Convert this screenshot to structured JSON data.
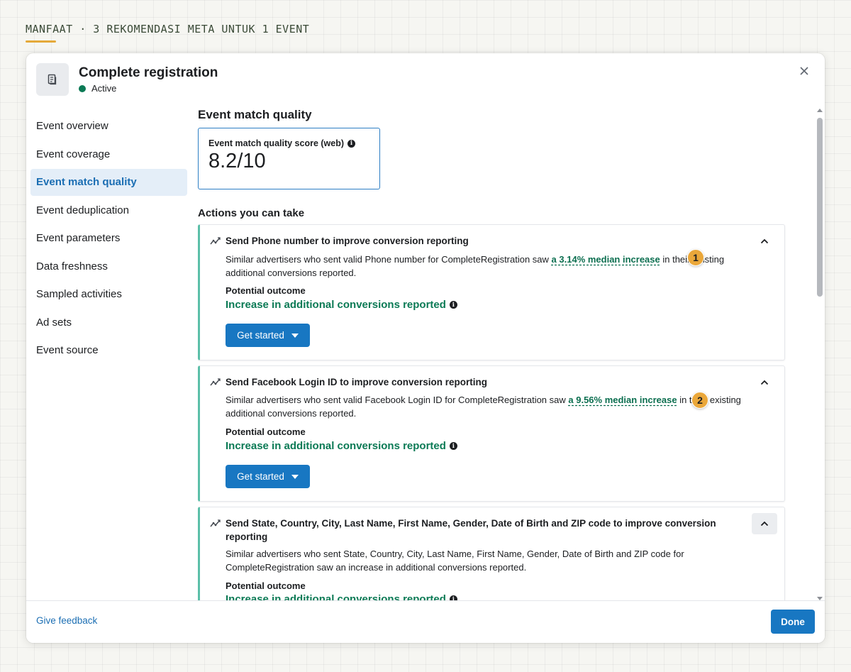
{
  "page": {
    "heading_tag": "MANFAAT · 3 REKOMENDASI META UNTUK 1 EVENT",
    "accent_color": "#e5a93a"
  },
  "modal": {
    "title": "Complete registration",
    "status": "Active",
    "status_color": "#0b7a55",
    "close_icon": "close-icon",
    "event_icon": "document-icon"
  },
  "sidebar": {
    "items": [
      {
        "label": "Event overview",
        "active": false
      },
      {
        "label": "Event coverage",
        "active": false
      },
      {
        "label": "Event match quality",
        "active": true
      },
      {
        "label": "Event deduplication",
        "active": false
      },
      {
        "label": "Event parameters",
        "active": false
      },
      {
        "label": "Data freshness",
        "active": false
      },
      {
        "label": "Sampled activities",
        "active": false
      },
      {
        "label": "Ad sets",
        "active": false
      },
      {
        "label": "Event source",
        "active": false
      }
    ]
  },
  "main": {
    "section_title": "Event match quality",
    "score_label": "Event match quality score (web)",
    "score_value": "8.2/10",
    "actions_title": "Actions you can take",
    "cards": [
      {
        "title": "Send Phone number to improve conversion reporting",
        "desc_before": "Similar advertisers who sent valid Phone number for CompleteRegistration saw ",
        "desc_link": "a 3.14% median increase",
        "desc_after": " in their existing additional conversions reported.",
        "outcome_label": "Potential outcome",
        "outcome_value": "Increase in additional conversions reported",
        "button_label": "Get started",
        "marker": "1"
      },
      {
        "title": "Send Facebook Login ID to improve conversion reporting",
        "desc_before": "Similar advertisers who sent valid Facebook Login ID for CompleteRegistration saw ",
        "desc_link": "a 9.56% median increase",
        "desc_after": " in their existing additional conversions reported.",
        "outcome_label": "Potential outcome",
        "outcome_value": "Increase in additional conversions reported",
        "button_label": "Get started",
        "marker": "2"
      },
      {
        "title": "Send State, Country, City, Last Name, First Name, Gender, Date of Birth and ZIP code to improve conversion reporting",
        "desc": "Similar advertisers who sent State, Country, City, Last Name, First Name, Gender, Date of Birth and ZIP code for CompleteRegistration saw an increase in additional conversions reported.",
        "outcome_label": "Potential outcome",
        "outcome_value": "Increase in additional conversions reported"
      }
    ]
  },
  "footer": {
    "feedback_label": "Give feedback",
    "done_label": "Done"
  }
}
